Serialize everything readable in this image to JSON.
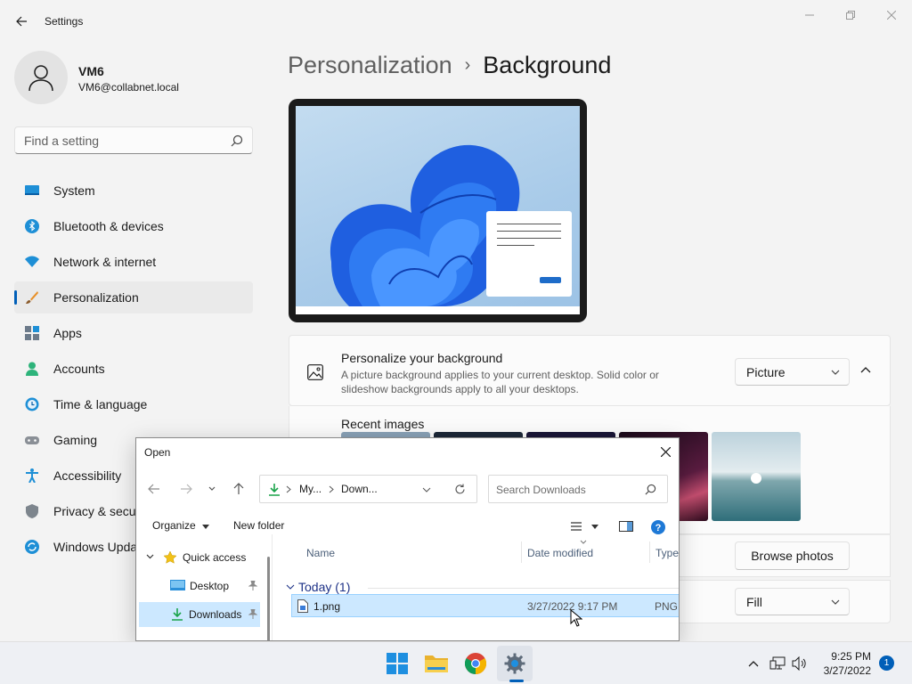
{
  "window": {
    "app_title": "Settings",
    "accent_color": "#005fb8"
  },
  "profile": {
    "name": "VM6",
    "email": "VM6@collabnet.local"
  },
  "search": {
    "placeholder": "Find a setting"
  },
  "nav": {
    "items": [
      {
        "label": "System",
        "icon": "system-icon"
      },
      {
        "label": "Bluetooth & devices",
        "icon": "bluetooth-icon"
      },
      {
        "label": "Network & internet",
        "icon": "wifi-icon"
      },
      {
        "label": "Personalization",
        "icon": "brush-icon",
        "active": true
      },
      {
        "label": "Apps",
        "icon": "apps-icon"
      },
      {
        "label": "Accounts",
        "icon": "accounts-icon"
      },
      {
        "label": "Time & language",
        "icon": "clock-icon"
      },
      {
        "label": "Gaming",
        "icon": "gamepad-icon"
      },
      {
        "label": "Accessibility",
        "icon": "accessibility-icon"
      },
      {
        "label": "Privacy & secur",
        "icon": "shield-icon"
      },
      {
        "label": "Windows Upda",
        "icon": "update-icon"
      }
    ]
  },
  "breadcrumb": {
    "parent": "Personalization",
    "separator": "›",
    "current": "Background"
  },
  "background_card": {
    "title": "Personalize your background",
    "description": "A picture background applies to your current desktop. Solid color or slideshow backgrounds apply to all your desktops.",
    "type_value": "Picture",
    "recent_images_label": "Recent images",
    "browse_label": "Browse photos",
    "fit_value": "Fill"
  },
  "dialog": {
    "title": "Open",
    "address": {
      "segment1": "My...",
      "segment2": "Down..."
    },
    "search_placeholder": "Search Downloads",
    "organize_label": "Organize",
    "new_folder_label": "New folder",
    "tree": {
      "quick_access": "Quick access",
      "desktop": "Desktop",
      "downloads": "Downloads"
    },
    "columns": {
      "name": "Name",
      "date_modified": "Date modified",
      "type": "Type"
    },
    "group_header": "Today (1)",
    "files": [
      {
        "name": "1.png",
        "date": "3/27/2022 9:17 PM",
        "type": "PNG"
      }
    ]
  },
  "taskbar": {
    "time": "9:25 PM",
    "date": "3/27/2022",
    "notification_count": "1"
  }
}
